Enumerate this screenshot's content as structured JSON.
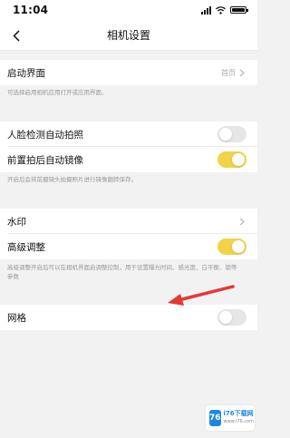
{
  "status_bar": {
    "time": "11:04"
  },
  "nav": {
    "title": "相机设置"
  },
  "settings": {
    "startup": {
      "label": "启动界面",
      "value": "首页"
    },
    "startup_hint": "可选择启用相机应用打开或应用界面。",
    "face_capture": {
      "label": "人脸检测自动拍照",
      "enabled": false
    },
    "front_mirror": {
      "label": "前置拍后自动镜像",
      "enabled": true
    },
    "mirror_hint": "开启后会将前摄镜头拍摄照片进行镜像翻转保存。",
    "watermark": {
      "label": "水印"
    },
    "advanced": {
      "label": "高级调整",
      "enabled": true
    },
    "advanced_hint": "高级调整开启后可以在相机界面启调整控制，用于设置曝光时间、感光度、白平衡、锁等参数",
    "grid": {
      "label": "网格",
      "enabled": false
    }
  },
  "watermark_badge": {
    "logo": "76",
    "name": "i76下载网",
    "url": "www.i76.com"
  },
  "colors": {
    "toggle_on": "#f1d34a",
    "toggle_off": "#e6e6e6",
    "annotation_arrow": "#e53935"
  }
}
